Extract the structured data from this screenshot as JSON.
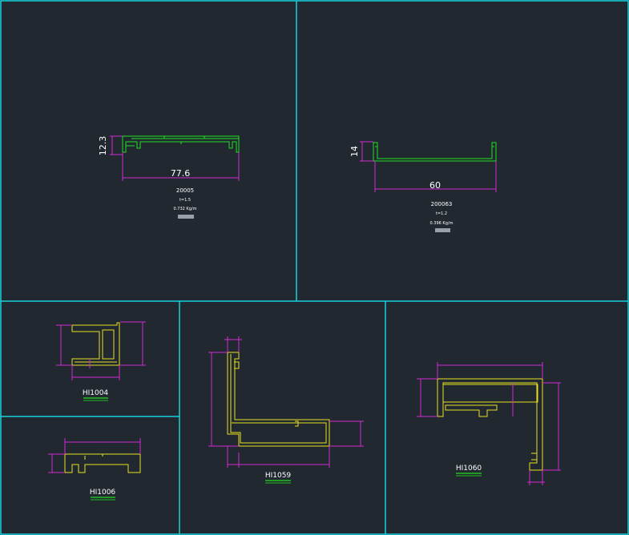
{
  "colors": {
    "background": "#212830",
    "frame": "#17d3dc",
    "dimension": "#d42ad4",
    "profile_green": "#20e020",
    "profile_yellow": "#e8e020",
    "underline_green": "#20c020",
    "text": "#ffffff"
  },
  "panels": {
    "p1": {
      "dim_width": "77.6",
      "dim_height": "12.3",
      "code": "20005",
      "thickness": "t=1.5",
      "weight": "0.732 Kg/m"
    },
    "p2": {
      "dim_width": "60",
      "dim_height": "14",
      "code": "200063",
      "thickness": "t=1.2",
      "weight": "0.396 Kg/m"
    },
    "p3": {
      "code": "HI1004"
    },
    "p4": {
      "code": "HI1006"
    },
    "p5": {
      "code": "HI1059"
    },
    "p6": {
      "code": "HI1060"
    }
  }
}
